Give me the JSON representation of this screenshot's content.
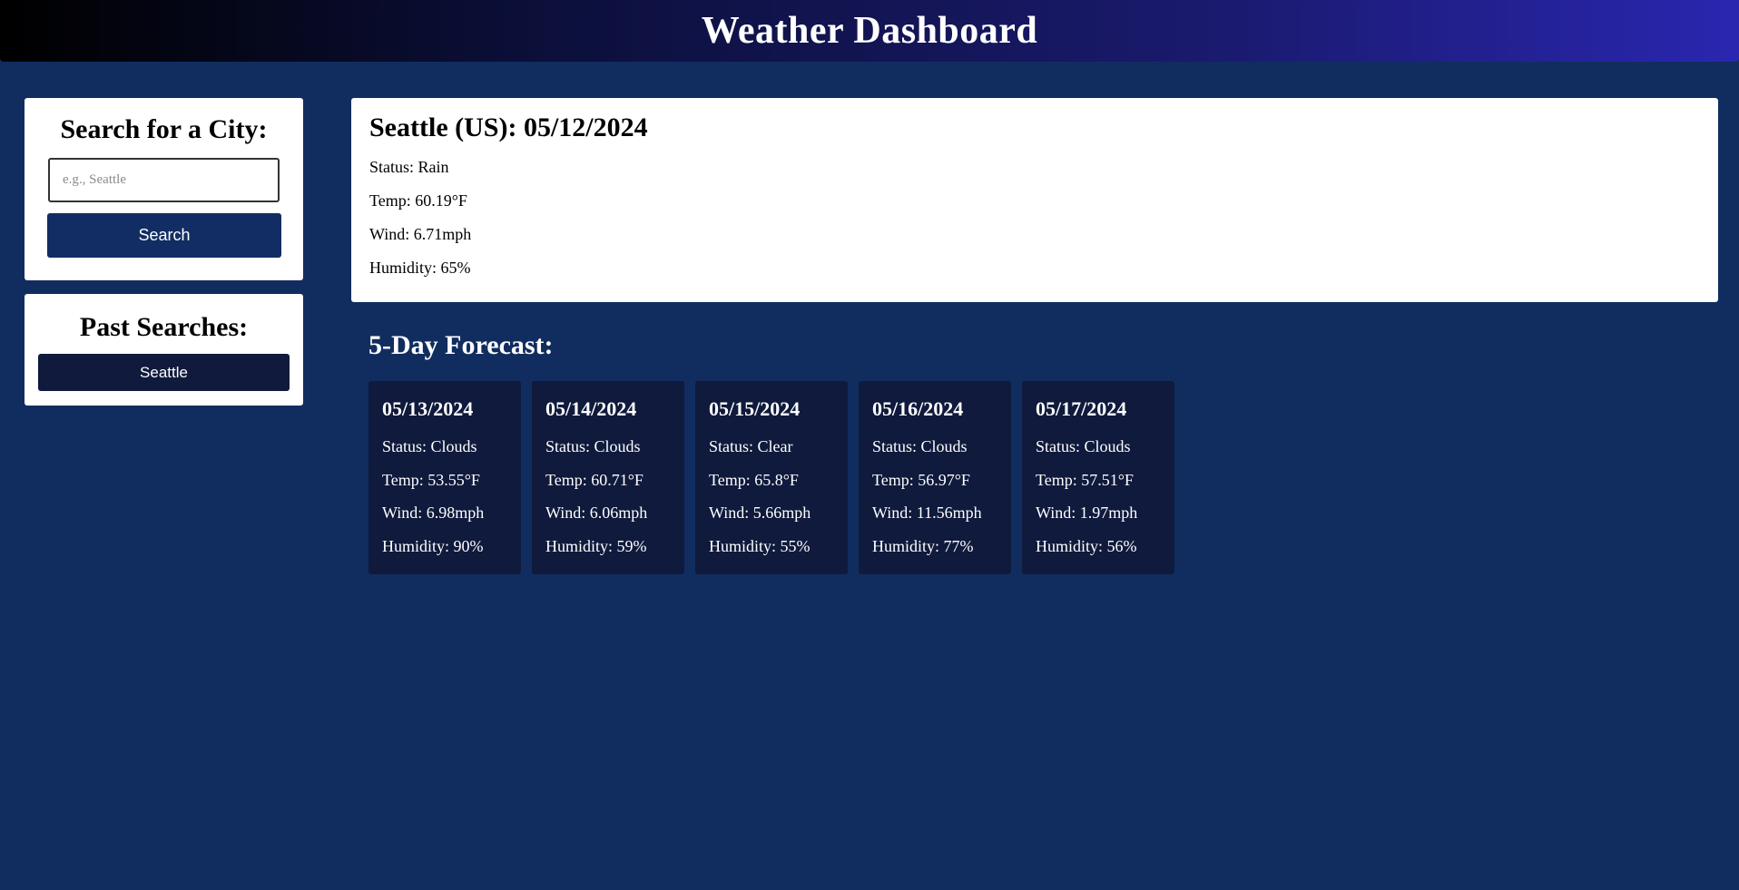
{
  "header": {
    "title": "Weather Dashboard"
  },
  "search": {
    "title": "Search for a City:",
    "placeholder": "e.g., Seattle",
    "value": "",
    "button_label": "Search"
  },
  "past_searches": {
    "title": "Past Searches:",
    "items": [
      "Seattle"
    ]
  },
  "current": {
    "heading": "Seattle (US): 05/12/2024",
    "status": "Status: Rain",
    "temp": "Temp: 60.19°F",
    "wind": "Wind: 6.71mph",
    "humidity": "Humidity: 65%"
  },
  "forecast": {
    "title": "5-Day Forecast:",
    "days": [
      {
        "date": "05/13/2024",
        "status": "Status: Clouds",
        "temp": "Temp: 53.55°F",
        "wind": "Wind: 6.98mph",
        "humidity": "Humidity: 90%"
      },
      {
        "date": "05/14/2024",
        "status": "Status: Clouds",
        "temp": "Temp: 60.71°F",
        "wind": "Wind: 6.06mph",
        "humidity": "Humidity: 59%"
      },
      {
        "date": "05/15/2024",
        "status": "Status: Clear",
        "temp": "Temp: 65.8°F",
        "wind": "Wind: 5.66mph",
        "humidity": "Humidity: 55%"
      },
      {
        "date": "05/16/2024",
        "status": "Status: Clouds",
        "temp": "Temp: 56.97°F",
        "wind": "Wind: 11.56mph",
        "humidity": "Humidity: 77%"
      },
      {
        "date": "05/17/2024",
        "status": "Status: Clouds",
        "temp": "Temp: 57.51°F",
        "wind": "Wind: 1.97mph",
        "humidity": "Humidity: 56%"
      }
    ]
  },
  "colors": {
    "page_background": "#112d60",
    "card_dark": "#0f1a3c",
    "button_primary": "#122d63",
    "header_gradient_start": "#000000",
    "header_gradient_end": "#2a26b0"
  }
}
